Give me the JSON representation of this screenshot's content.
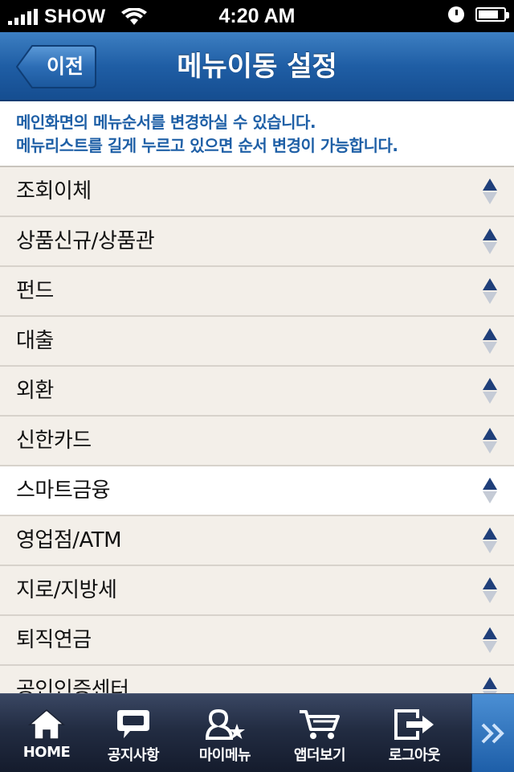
{
  "status_bar": {
    "carrier": "SHOW",
    "time": "4:20 AM"
  },
  "nav": {
    "back_label": "이전",
    "title": "메뉴이동 설정"
  },
  "info": {
    "line1": "메인화면의 메뉴순서를 변경하실 수 있습니다.",
    "line2": "메뉴리스트를 길게 누르고 있으면 순서 변경이 가능합니다."
  },
  "menu": {
    "items": [
      {
        "label": "조회이체"
      },
      {
        "label": "상품신규/상품관"
      },
      {
        "label": "펀드"
      },
      {
        "label": "대출"
      },
      {
        "label": "외환"
      },
      {
        "label": "신한카드"
      },
      {
        "label": "스마트금융"
      },
      {
        "label": "영업점/ATM"
      },
      {
        "label": "지로/지방세"
      },
      {
        "label": "퇴직연금"
      },
      {
        "label": "공인인증센터"
      }
    ],
    "selected_index": 6
  },
  "tabbar": {
    "tabs": [
      {
        "label": "HOME",
        "icon": "home-icon"
      },
      {
        "label": "공지사항",
        "icon": "speech-bubble-icon"
      },
      {
        "label": "마이메뉴",
        "icon": "person-star-icon"
      },
      {
        "label": "앱더보기",
        "icon": "cart-icon"
      },
      {
        "label": "로그아웃",
        "icon": "logout-icon"
      }
    ],
    "more_icon": "double-chevron-right-icon"
  },
  "colors": {
    "nav_blue": "#1f5ea5",
    "info_text": "#1e5fa6",
    "list_bg": "#f3efe9"
  }
}
